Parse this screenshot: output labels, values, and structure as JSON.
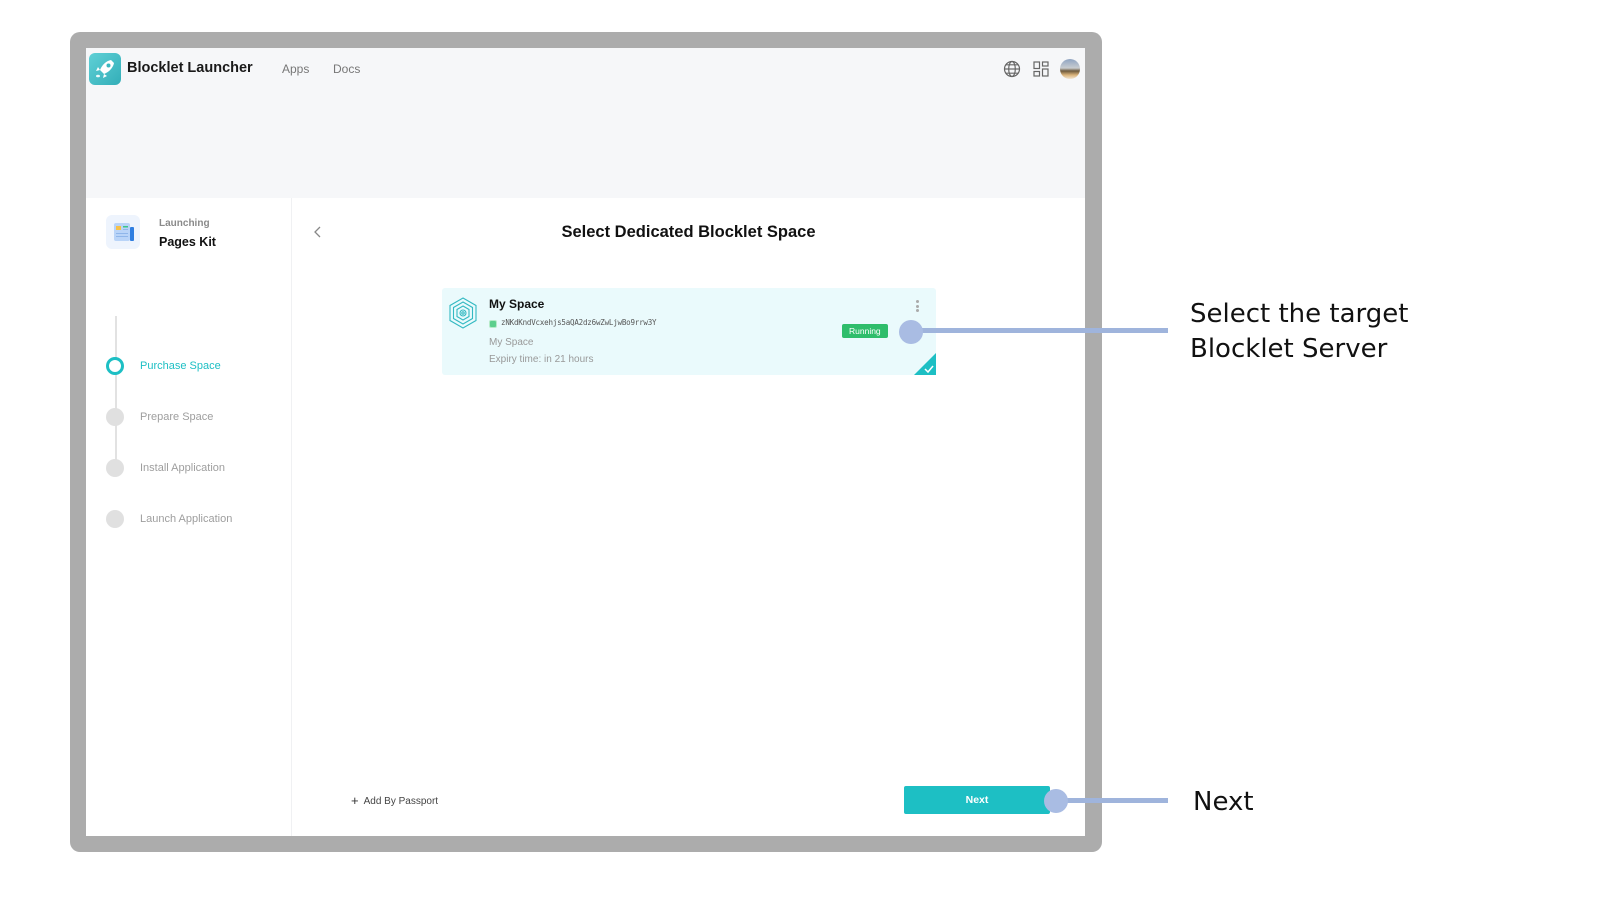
{
  "header": {
    "app_title": "Blocklet Launcher",
    "nav": [
      {
        "label": "Apps"
      },
      {
        "label": "Docs"
      }
    ],
    "icons": [
      "globe-icon",
      "apps-grid-icon",
      "user-avatar"
    ]
  },
  "sidebar": {
    "launching_label": "Launching",
    "app_name": "Pages Kit",
    "steps": [
      {
        "label": "Purchase Space",
        "state": "active"
      },
      {
        "label": "Prepare Space",
        "state": "pending"
      },
      {
        "label": "Install Application",
        "state": "pending"
      },
      {
        "label": "Launch Application",
        "state": "pending"
      }
    ]
  },
  "main": {
    "title": "Select Dedicated Blocklet Space",
    "spaces": [
      {
        "name": "My Space",
        "did": "zNKdKndVcxehjs5aQA2dz6wZwLjwBo9rrw3Y",
        "description": "My Space",
        "expiry": "Expiry time: in 21 hours",
        "status": "Running",
        "selected": true
      }
    ],
    "add_by_passport_label": "Add By Passport",
    "next_label": "Next"
  },
  "annotations": {
    "select_target": "Select the target\nBlocklet Server",
    "next": "Next"
  },
  "colors": {
    "accent": "#1dbfc4",
    "status_running": "#2fbd6b",
    "callout": "#9fb4dc",
    "card_bg": "#eafafc"
  }
}
